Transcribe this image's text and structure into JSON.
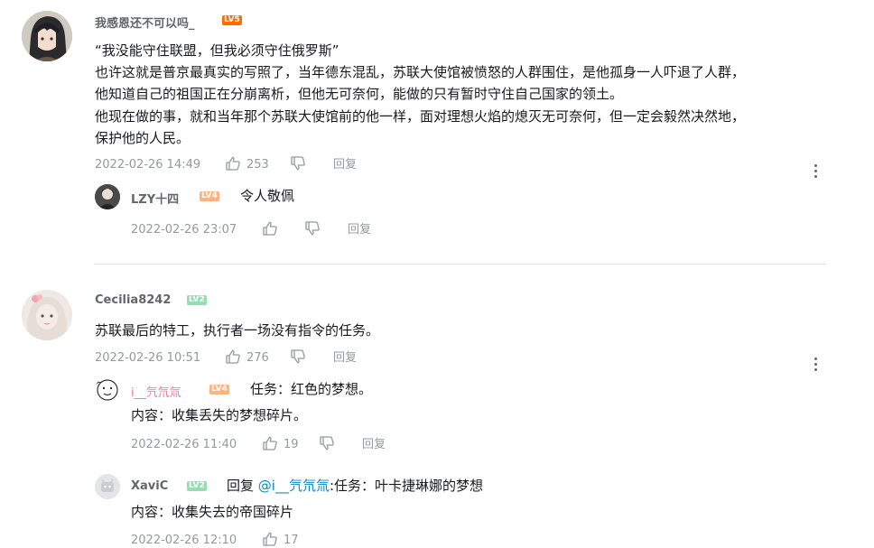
{
  "comments": [
    {
      "user": "我感恩还不可以吗_",
      "level": "LV5",
      "lines": [
        "“我没能守住联盟，但我必须守住俄罗斯”",
        "也许这就是普京最真实的写照了，当年德东混乱，苏联大使馆被愤怒的人群围住，是他孤身一人吓退了人群，",
        "他知道自己的祖国正在分崩离析，但他无可奈何，能做的只有暂时守住自己国家的领土。",
        "他现在做的事，就和当年那个苏联大使馆前的他一样，面对理想火焰的熄灭无可奈何，但一定会毅然决然地，",
        "保护他的人民。"
      ],
      "time": "2022-02-26 14:49",
      "likes": "253",
      "reply_label": "回复",
      "replies": [
        {
          "user": "LZY十四",
          "level": "LV4",
          "text": "令人敬佩",
          "time": "2022-02-26 23:07",
          "likes": "",
          "reply_label": "回复"
        }
      ]
    },
    {
      "user": "Cecilia8242",
      "level": "LV2",
      "lines": [
        "苏联最后的特工，执行者一场没有指令的任务。"
      ],
      "time": "2022-02-26 10:51",
      "likes": "276",
      "reply_label": "回复",
      "replies": [
        {
          "user": "i__氕氘氚",
          "level": "LV4",
          "text": "任务：红色的梦想。",
          "text2": "内容：收集丢失的梦想碎片。",
          "time": "2022-02-26 11:40",
          "likes": "19",
          "reply_label": "回复"
        },
        {
          "user": "XaviC",
          "level": "LV2",
          "prefix": "回复",
          "mention": "@i__氕氘氚",
          "text": ":任务：叶卡捷琳娜的梦想",
          "text2": "内容：收集失去的帝国碎片",
          "time": "2022-02-26 12:10",
          "likes": "17",
          "reply_label": "回复"
        }
      ]
    }
  ],
  "icons": {
    "like": "thumbs-up-icon",
    "dislike": "thumbs-down-icon",
    "more": "more-vertical-icon"
  },
  "colors": {
    "username": "#61666d",
    "meta": "#9499a0",
    "pink_name": "#fb7299",
    "mention": "#008ac5",
    "lv5": "#ff6c00",
    "lv4": "#ffb37c",
    "lv2": "#95ddb2"
  }
}
